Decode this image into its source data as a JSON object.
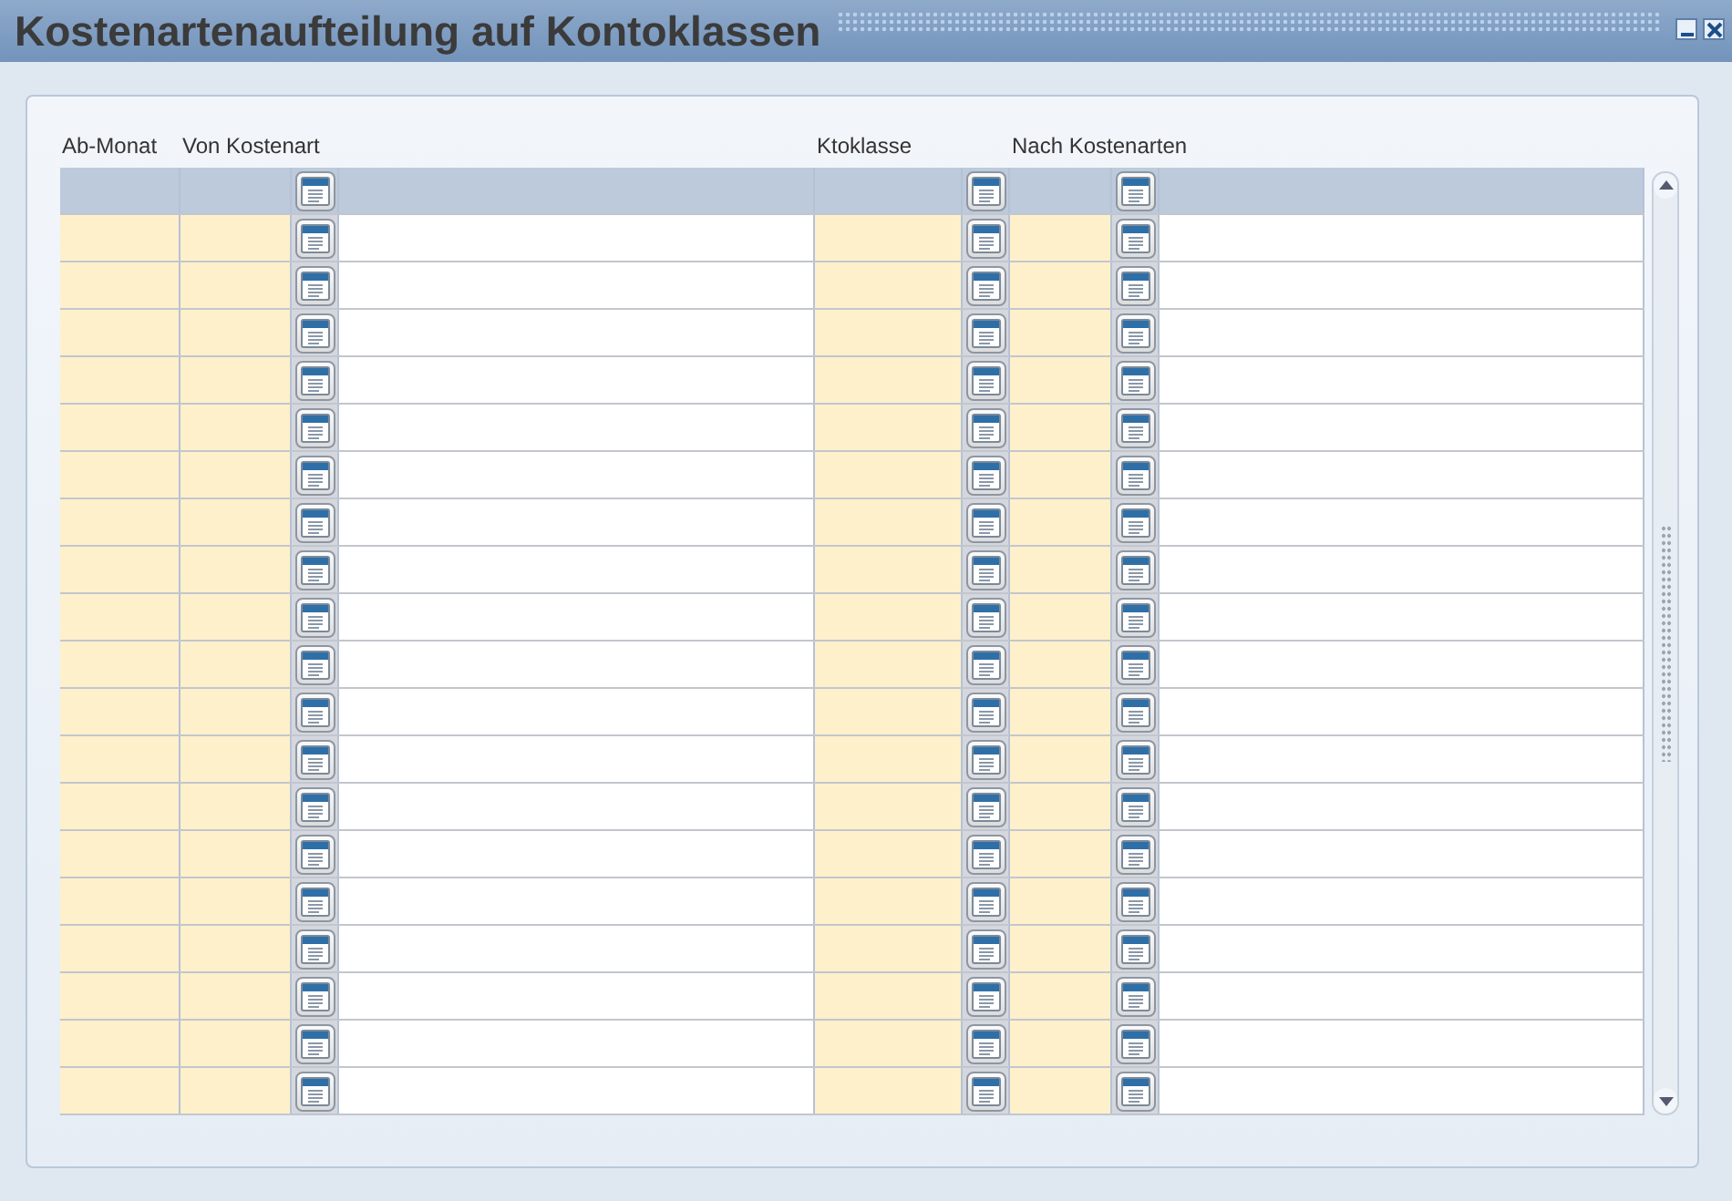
{
  "window": {
    "title": "Kostenartenaufteilung auf Kontoklassen"
  },
  "columns": [
    "Ab-Monat",
    "Von Kostenart",
    "Ktoklasse",
    "Nach Kostenarten"
  ],
  "rows": [
    {
      "kind": "filter"
    },
    {
      "kind": "record"
    },
    {
      "kind": "record"
    },
    {
      "kind": "record"
    },
    {
      "kind": "record"
    },
    {
      "kind": "record"
    },
    {
      "kind": "record"
    },
    {
      "kind": "record"
    },
    {
      "kind": "record"
    },
    {
      "kind": "record"
    },
    {
      "kind": "record"
    },
    {
      "kind": "record"
    },
    {
      "kind": "record"
    },
    {
      "kind": "record"
    },
    {
      "kind": "record"
    },
    {
      "kind": "record"
    },
    {
      "kind": "record"
    },
    {
      "kind": "record"
    },
    {
      "kind": "record"
    },
    {
      "kind": "record"
    }
  ]
}
